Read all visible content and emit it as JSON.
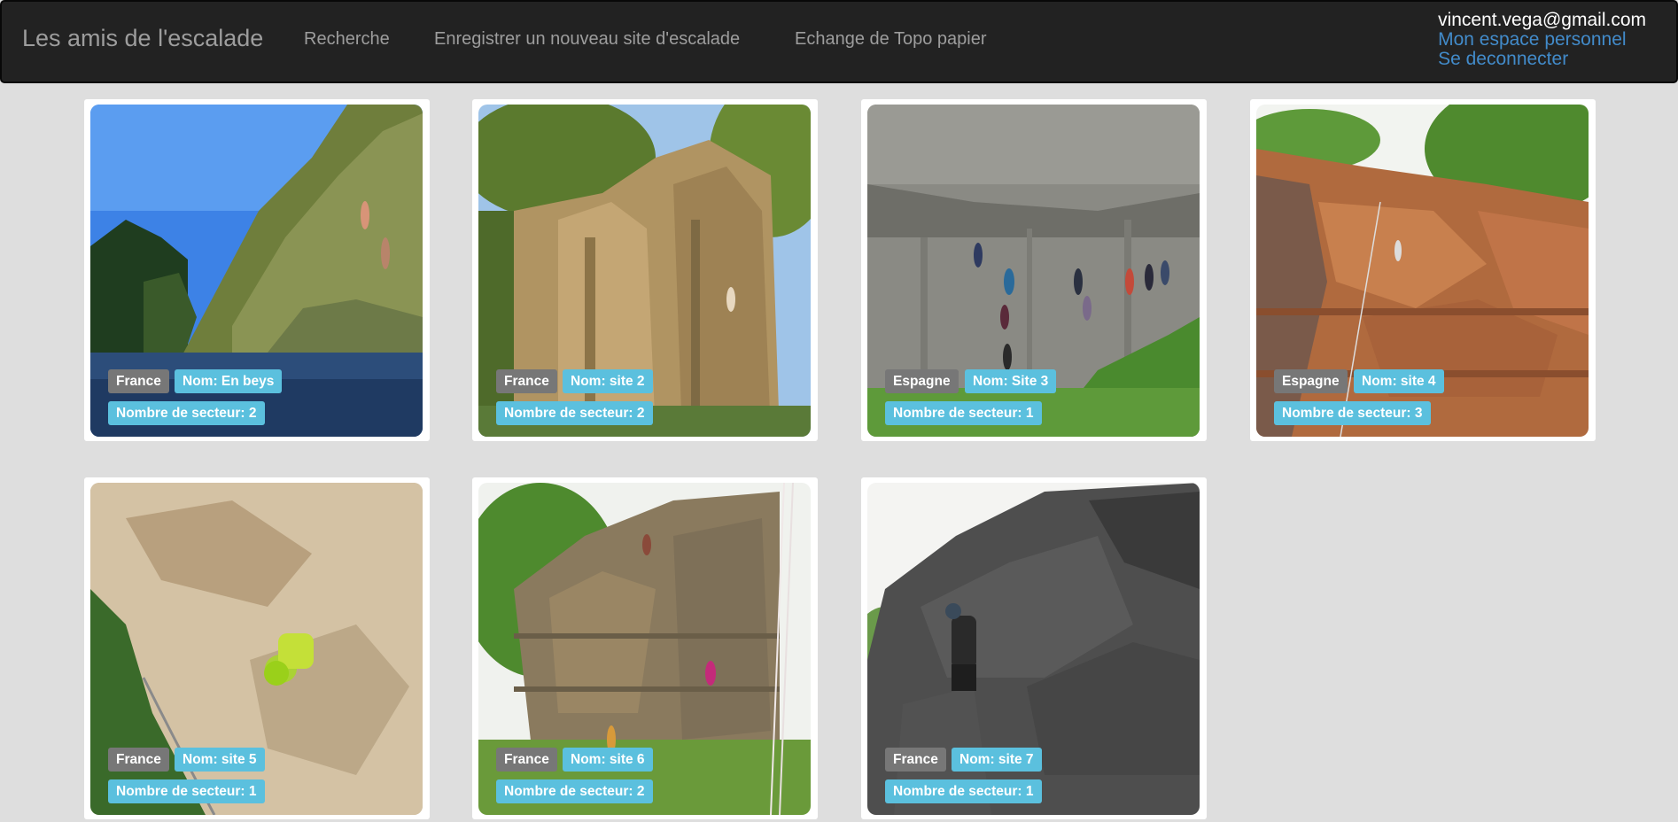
{
  "navbar": {
    "brand": "Les amis de l'escalade",
    "links": [
      "Recherche",
      "Enregistrer un nouveau site d'escalade",
      "Echange de Topo papier"
    ],
    "user_email": "vincent.vega@gmail.com",
    "personal_space": "Mon espace personnel",
    "logout": "Se deconnecter"
  },
  "colors": {
    "navbar_bg": "#222222",
    "page_bg": "#dedede",
    "label_default": "#777777",
    "label_info": "#5bc0de",
    "link": "#428bca"
  },
  "sites": [
    {
      "country": "France",
      "name": "Nom: En beys",
      "sectors": "Nombre de secteur: 2",
      "photo": "climber-on-slab-above-water"
    },
    {
      "country": "France",
      "name": "Nom: site 2",
      "sectors": "Nombre de secteur: 2",
      "photo": "limestone-pillar-with-trees"
    },
    {
      "country": "Espagne",
      "name": "Nom: Site 3",
      "sectors": "Nombre de secteur: 1",
      "photo": "grey-wall-group-of-climbers"
    },
    {
      "country": "Espagne",
      "name": "Nom: site 4",
      "sectors": "Nombre de secteur: 3",
      "photo": "orange-sandstone-wall"
    },
    {
      "country": "France",
      "name": "Nom: site 5",
      "sectors": "Nombre de secteur: 1",
      "photo": "overhang-climber-green-helmet"
    },
    {
      "country": "France",
      "name": "Nom: site 6",
      "sectors": "Nombre de secteur: 2",
      "photo": "layered-cliff-with-climbers"
    },
    {
      "country": "France",
      "name": "Nom: site 7",
      "sectors": "Nombre de secteur: 1",
      "photo": "dark-granite-boulder-climber"
    }
  ]
}
